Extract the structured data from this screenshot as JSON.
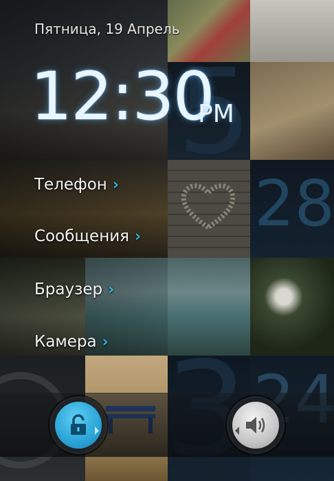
{
  "lockscreen": {
    "date": "Пятница, 19 Апрель",
    "time": "12:30",
    "ampm": "PM",
    "shortcuts": [
      {
        "label": "Телефон"
      },
      {
        "label": "Сообщения"
      },
      {
        "label": "Браузер"
      },
      {
        "label": "Камера"
      }
    ],
    "chevron": "›",
    "unlock_icon": "lock-open-icon",
    "sound_icon": "speaker-icon"
  },
  "wallpaper": {
    "numbers": [
      "5",
      "28",
      "3",
      "24"
    ]
  },
  "colors": {
    "accent": "#33b5e5",
    "clock_glow": "#5ab4ff"
  }
}
